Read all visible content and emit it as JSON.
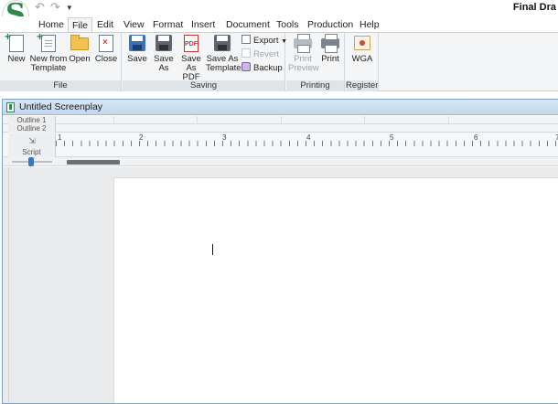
{
  "app": {
    "window_title": "Final Dra",
    "logo_icon": "final-draft-logo",
    "brand_color": "#2f8a4a"
  },
  "quick_access": {
    "undo_icon": "undo-icon",
    "redo_icon": "redo-icon",
    "customize_icon": "dropdown-arrow-icon"
  },
  "menu": {
    "tabs": [
      "Home",
      "File",
      "Edit",
      "View",
      "Format",
      "Insert",
      "Document",
      "Tools",
      "Production",
      "Help"
    ],
    "active": "File"
  },
  "ribbon": {
    "groups": {
      "file": {
        "label": "File",
        "new": "New",
        "new_from_template_1": "New from",
        "new_from_template_2": "Template",
        "open": "Open",
        "close": "Close"
      },
      "saving": {
        "label": "Saving",
        "save": "Save",
        "save_as_1": "Save",
        "save_as_2": "As",
        "save_as_pdf_1": "Save",
        "save_as_pdf_2": "As PDF",
        "save_as_pdf_icon_text": "PDF",
        "save_as_template_1": "Save As",
        "save_as_template_2": "Template",
        "export": "Export",
        "revert": "Revert",
        "backup": "Backup"
      },
      "printing": {
        "label": "Printing",
        "print_preview_1": "Print",
        "print_preview_2": "Preview",
        "print": "Print"
      },
      "register": {
        "label": "Register",
        "wga": "WGA"
      }
    }
  },
  "document": {
    "title": "Untitled Screenplay",
    "outline_1": "Outline 1",
    "outline_2": "Outline 2",
    "element": "Script",
    "ruler_numbers": [
      "1",
      "2",
      "3",
      "4",
      "5",
      "6",
      "7"
    ]
  }
}
